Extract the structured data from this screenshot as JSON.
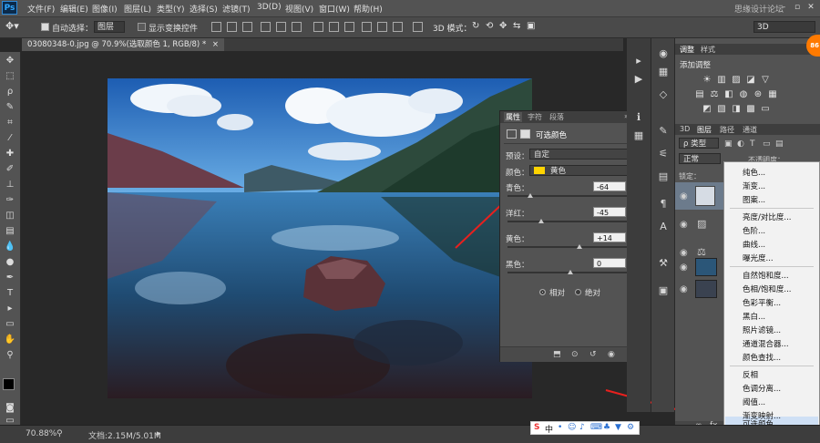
{
  "app": {
    "logo": "Ps",
    "watermark": "思缘设计论坛"
  },
  "menu": [
    "文件(F)",
    "编辑(E)",
    "图像(I)",
    "图层(L)",
    "类型(Y)",
    "选择(S)",
    "滤镜(T)",
    "3D(D)",
    "视图(V)",
    "窗口(W)",
    "帮助(H)"
  ],
  "options": {
    "auto_select_label": "自动选择：",
    "auto_select_value": "图层",
    "show_transform_label": "显示变换控件",
    "mode3d_label": "3D 模式：",
    "workspace_value": "3D"
  },
  "document": {
    "tab_title": "03080348-0.jpg @ 70.9%(选取颜色 1, RGB/8) *",
    "close": "×"
  },
  "status": {
    "zoom": "70.88%",
    "doc_size": "文档:2.15M/5.01M"
  },
  "properties": {
    "tabs": [
      "属性",
      "字符",
      "段落"
    ],
    "title": "可选颜色",
    "preset_label": "预设：",
    "preset_value": "自定",
    "colors_label": "颜色：",
    "colors_value": "黄色",
    "swatch_color": "#ffd400",
    "sliders": [
      {
        "label": "青色：",
        "value": "-64",
        "unit": "%",
        "pos": 0.18
      },
      {
        "label": "洋红：",
        "value": "-45",
        "unit": "%",
        "pos": 0.27
      },
      {
        "label": "黄色：",
        "value": "+14",
        "unit": "%",
        "pos": 0.57
      },
      {
        "label": "黑色：",
        "value": "0",
        "unit": "%",
        "pos": 0.5
      }
    ],
    "method_relative": "相对",
    "method_absolute": "绝对"
  },
  "right_panel": {
    "tabs_top": [
      "调整",
      "样式"
    ],
    "add_adjustment": "添加调整",
    "tabs_layers": [
      "3D",
      "图层",
      "路径",
      "通道"
    ],
    "kind_label": "ρ 类型",
    "blend_mode": "正常",
    "opacity_label": "不透明度：",
    "opacity_value": "100%",
    "lock_label": "锁定："
  },
  "context_menu": {
    "items": [
      "纯色...",
      "渐变...",
      "图案...",
      "亮度/对比度...",
      "色阶...",
      "曲线...",
      "曝光度...",
      "自然饱和度...",
      "色相/饱和度...",
      "色彩平衡...",
      "黑白...",
      "照片滤镜...",
      "通道混合器...",
      "颜色查找...",
      "反相",
      "色调分离...",
      "阈值...",
      "渐变映射...",
      "可选颜色..."
    ],
    "highlighted": "可选颜色..."
  },
  "ime": {
    "logo": "S",
    "mode": "中"
  },
  "avatar_text": "86",
  "arrow_color": "#e8201e"
}
